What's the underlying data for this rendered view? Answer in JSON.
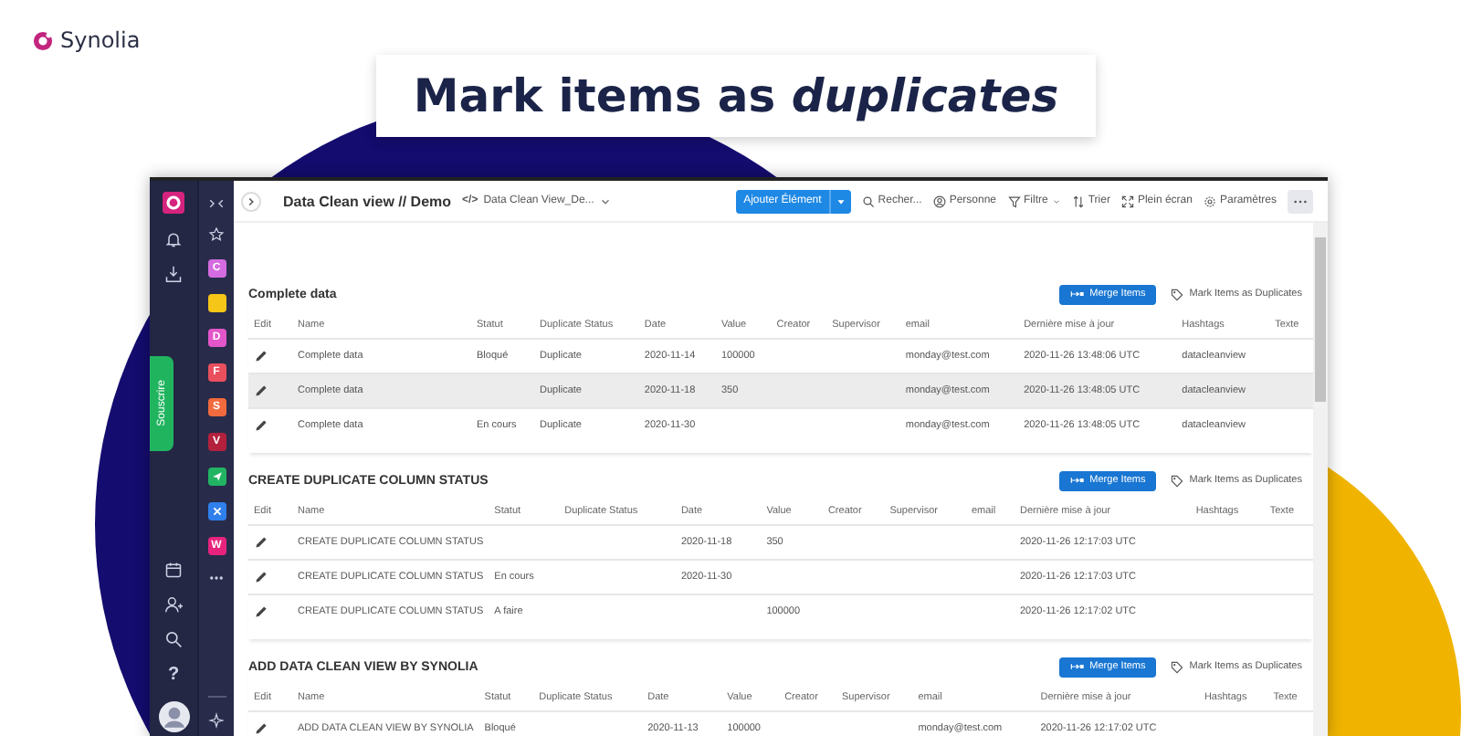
{
  "brand": {
    "name": "Synolia"
  },
  "headline": "Mark items as *duplicates*",
  "rail_apps": [
    {
      "kind": "letter",
      "letter": "C",
      "color": "#d56be0"
    },
    {
      "kind": "blank",
      "color": "#f5c518"
    },
    {
      "kind": "letter",
      "letter": "D",
      "color": "#e356c9"
    },
    {
      "kind": "letter",
      "letter": "F",
      "color": "#ea4f5e"
    },
    {
      "kind": "letter",
      "letter": "S",
      "color": "#f26a3d"
    },
    {
      "kind": "letter",
      "letter": "V",
      "color": "#b3213d"
    },
    {
      "kind": "send",
      "color": "#22b463"
    },
    {
      "kind": "tool",
      "color": "#2f80ed"
    },
    {
      "kind": "letter",
      "letter": "W",
      "color": "#e8237d"
    }
  ],
  "subscribe_tab": "Souscrire",
  "help": "?",
  "toolbar": {
    "title": "Data Clean view // Demo",
    "view_icon": "</>",
    "view": "Data Clean View_De...",
    "add_button": "Ajouter Élément",
    "actions": [
      {
        "kind": "search",
        "label": "Recher...",
        "dropdown": false
      },
      {
        "kind": "person",
        "label": "Personne",
        "dropdown": false
      },
      {
        "kind": "filter",
        "label": "Filtre",
        "dropdown": true
      },
      {
        "kind": "sort",
        "label": "Trier",
        "dropdown": false
      },
      {
        "kind": "fullscreen",
        "label": "Plein écran",
        "dropdown": false
      },
      {
        "kind": "settings",
        "label": "Paramètres",
        "dropdown": false
      }
    ]
  },
  "sections": [
    {
      "title": "Complete data",
      "merge_button": "Merge Items",
      "mark_link": "Mark Items as Duplicates",
      "columns": [
        "Edit",
        "Name",
        "Statut",
        "Duplicate Status",
        "Date",
        "Value",
        "Creator",
        "Supervisor",
        "email",
        "Dernière mise à jour",
        "Hashtags",
        "Texte"
      ],
      "rows": [
        {
          "selected": false,
          "cells": [
            "",
            "Complete data",
            "Bloqué",
            "Duplicate",
            "2020-11-14",
            "100000",
            "",
            "",
            "monday@test.com",
            "2020-11-26 13:48:06 UTC",
            "datacleanview",
            ""
          ]
        },
        {
          "selected": true,
          "cells": [
            "",
            "Complete data",
            "",
            "Duplicate",
            "2020-11-18",
            "350",
            "",
            "",
            "monday@test.com",
            "2020-11-26 13:48:05 UTC",
            "datacleanview",
            ""
          ]
        },
        {
          "selected": false,
          "cells": [
            "",
            "Complete data",
            "En cours",
            "Duplicate",
            "2020-11-30",
            "",
            "",
            "",
            "monday@test.com",
            "2020-11-26 13:48:05 UTC",
            "datacleanview",
            ""
          ]
        }
      ]
    },
    {
      "title": "CREATE DUPLICATE COLUMN STATUS",
      "merge_button": "Merge Items",
      "mark_link": "Mark Items as Duplicates",
      "columns": [
        "Edit",
        "Name",
        "Statut",
        "Duplicate Status",
        "Date",
        "Value",
        "Creator",
        "Supervisor",
        "email",
        "Dernière mise à jour",
        "Hashtags",
        "Texte"
      ],
      "rows": [
        {
          "selected": false,
          "cells": [
            "",
            "CREATE DUPLICATE COLUMN STATUS",
            "",
            "",
            "2020-11-18",
            "350",
            "",
            "",
            "",
            "2020-11-26 12:17:03 UTC",
            "",
            ""
          ]
        },
        {
          "selected": false,
          "cells": [
            "",
            "CREATE DUPLICATE COLUMN STATUS",
            "En cours",
            "",
            "2020-11-30",
            "",
            "",
            "",
            "",
            "2020-11-26 12:17:03 UTC",
            "",
            ""
          ]
        },
        {
          "selected": false,
          "cells": [
            "",
            "CREATE DUPLICATE COLUMN STATUS",
            "A faire",
            "",
            "",
            "100000",
            "",
            "",
            "",
            "2020-11-26 12:17:02 UTC",
            "",
            ""
          ]
        }
      ]
    },
    {
      "title": "ADD DATA CLEAN VIEW BY SYNOLIA",
      "merge_button": "Merge Items",
      "mark_link": "Mark Items as Duplicates",
      "columns": [
        "Edit",
        "Name",
        "Statut",
        "Duplicate Status",
        "Date",
        "Value",
        "Creator",
        "Supervisor",
        "email",
        "Dernière mise à jour",
        "Hashtags",
        "Texte"
      ],
      "rows": [
        {
          "selected": false,
          "cells": [
            "",
            "ADD DATA CLEAN VIEW BY SYNOLIA",
            "Bloqué",
            "",
            "2020-11-13",
            "100000",
            "",
            "",
            "monday@test.com",
            "2020-11-26 12:17:02 UTC",
            "",
            ""
          ]
        }
      ]
    }
  ]
}
